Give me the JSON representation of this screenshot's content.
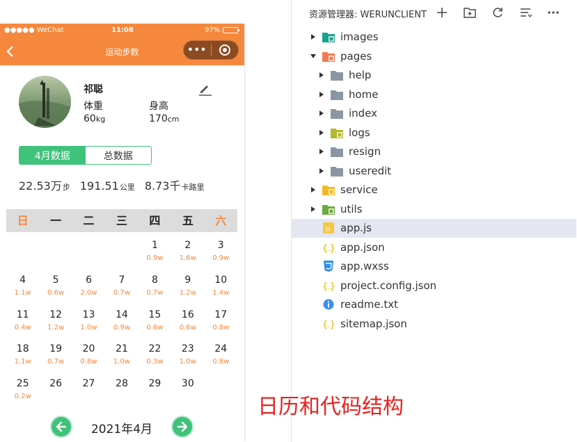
{
  "status_bar": {
    "carrier": "●●●●● WeChat",
    "time": "11:08",
    "battery": "97%",
    "battery_level": 0.97
  },
  "nav": {
    "title": "运动步数",
    "capsule_dots": "•••"
  },
  "profile": {
    "name": "祁聪",
    "weight_label": "体重",
    "weight_value": "60",
    "weight_unit": "kg",
    "height_label": "身高",
    "height_value": "170",
    "height_unit": "cm"
  },
  "tabs": {
    "month": "4月数据",
    "total": "总数据"
  },
  "totals": {
    "steps": "22.53",
    "steps_unit_big": "万",
    "steps_unit": "步",
    "distance": "191.51",
    "distance_unit": "公里",
    "calories": "8.73",
    "calories_unit_big": "千",
    "calories_unit": "卡路里"
  },
  "calendar": {
    "weekdays": [
      "日",
      "一",
      "二",
      "三",
      "四",
      "五",
      "六"
    ],
    "weeks": [
      [
        {
          "d": "",
          "s": ""
        },
        {
          "d": "",
          "s": ""
        },
        {
          "d": "",
          "s": ""
        },
        {
          "d": "",
          "s": ""
        },
        {
          "d": "1",
          "s": "0.9w"
        },
        {
          "d": "2",
          "s": "1.6w"
        },
        {
          "d": "3",
          "s": "0.9w"
        }
      ],
      [
        {
          "d": "4",
          "s": "1.1w"
        },
        {
          "d": "5",
          "s": "0.6w"
        },
        {
          "d": "6",
          "s": "2.0w"
        },
        {
          "d": "7",
          "s": "0.7w"
        },
        {
          "d": "8",
          "s": "0.7w"
        },
        {
          "d": "9",
          "s": "1.2w"
        },
        {
          "d": "10",
          "s": "1.4w"
        }
      ],
      [
        {
          "d": "11",
          "s": "0.4w"
        },
        {
          "d": "12",
          "s": "1.2w"
        },
        {
          "d": "13",
          "s": "1.0w"
        },
        {
          "d": "14",
          "s": "0.9w"
        },
        {
          "d": "15",
          "s": "0.6w"
        },
        {
          "d": "16",
          "s": "0.6w"
        },
        {
          "d": "17",
          "s": "0.8w"
        }
      ],
      [
        {
          "d": "18",
          "s": "1.1w"
        },
        {
          "d": "19",
          "s": "0.7w"
        },
        {
          "d": "20",
          "s": "0.8w"
        },
        {
          "d": "21",
          "s": "1.0w"
        },
        {
          "d": "22",
          "s": "0.3w"
        },
        {
          "d": "23",
          "s": "1.0w"
        },
        {
          "d": "24",
          "s": "0.8w"
        }
      ],
      [
        {
          "d": "25",
          "s": "0.2w"
        },
        {
          "d": "26",
          "s": ""
        },
        {
          "d": "27",
          "s": ""
        },
        {
          "d": "28",
          "s": ""
        },
        {
          "d": "29",
          "s": ""
        },
        {
          "d": "30",
          "s": ""
        },
        {
          "d": "",
          "s": ""
        }
      ]
    ],
    "month_label": "2021年4月"
  },
  "explorer": {
    "title": "资源管理器: WERUNCLIENT",
    "toolbar_icons": [
      "add-file-icon",
      "new-folder-icon",
      "refresh-icon",
      "collapse-icon",
      "more-icon"
    ],
    "items": [
      {
        "label": "images",
        "icon": "folder-images",
        "kind": "folder",
        "expanded": false,
        "depth": 0
      },
      {
        "label": "pages",
        "icon": "folder-pages",
        "kind": "folder",
        "expanded": true,
        "depth": 0
      },
      {
        "label": "help",
        "icon": "folder",
        "kind": "folder",
        "expanded": false,
        "depth": 1
      },
      {
        "label": "home",
        "icon": "folder",
        "kind": "folder",
        "expanded": false,
        "depth": 1
      },
      {
        "label": "index",
        "icon": "folder",
        "kind": "folder",
        "expanded": false,
        "depth": 1
      },
      {
        "label": "logs",
        "icon": "folder-logs",
        "kind": "folder",
        "expanded": false,
        "depth": 1
      },
      {
        "label": "resign",
        "icon": "folder",
        "kind": "folder",
        "expanded": false,
        "depth": 1
      },
      {
        "label": "useredit",
        "icon": "folder",
        "kind": "folder",
        "expanded": false,
        "depth": 1
      },
      {
        "label": "service",
        "icon": "folder-service",
        "kind": "folder",
        "expanded": false,
        "depth": 0
      },
      {
        "label": "utils",
        "icon": "folder-utils",
        "kind": "folder",
        "expanded": false,
        "depth": 0
      },
      {
        "label": "app.js",
        "icon": "js-file",
        "kind": "file",
        "selected": true,
        "depth": 0
      },
      {
        "label": "app.json",
        "icon": "json-file",
        "kind": "file",
        "depth": 0
      },
      {
        "label": "app.wxss",
        "icon": "css-file",
        "kind": "file",
        "depth": 0
      },
      {
        "label": "project.config.json",
        "icon": "json-file",
        "kind": "file",
        "depth": 0
      },
      {
        "label": "readme.txt",
        "icon": "info-file",
        "kind": "file",
        "depth": 0
      },
      {
        "label": "sitemap.json",
        "icon": "json-file",
        "kind": "file",
        "depth": 0
      }
    ]
  },
  "caption": "日历和代码结构",
  "colors": {
    "accent": "#f5883d",
    "green": "#3fc27a",
    "caption": "#e8211f",
    "selected_row": "#e4e6f1"
  }
}
